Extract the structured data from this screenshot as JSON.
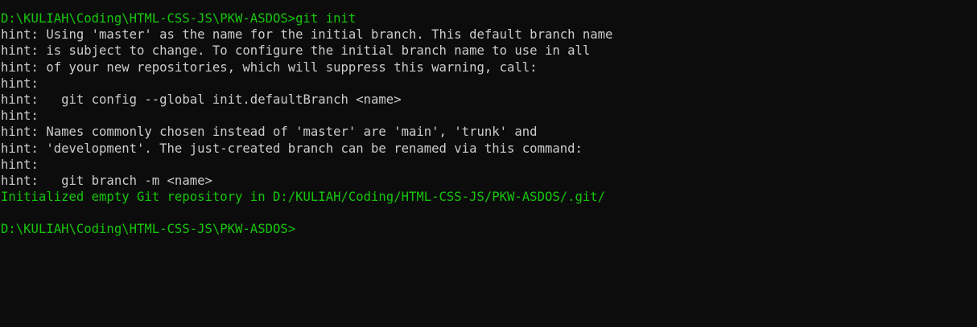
{
  "terminal": {
    "colors": {
      "background": "#0c0c0c",
      "text": "#cccccc",
      "prompt": "#16c60c"
    },
    "lines": [
      "hint: Using 'master' as the name for the initial branch. This default branch name",
      "hint: is subject to change. To configure the initial branch name to use in all",
      "hint: of your new repositories, which will suppress this warning, call:",
      "hint:",
      "hint:   git config --global init.defaultBranch <name>",
      "hint:",
      "hint: Names commonly chosen instead of 'master' are 'main', 'trunk' and",
      "hint: 'development'. The just-created branch can be renamed via this command:",
      "hint:",
      "hint:   git branch -m <name>",
      "Initialized empty Git repository in D:/KULIAH/Coding/HTML-CSS-JS/PKW-ASDOS/.git/"
    ],
    "prompt_path": "D:\\KULIAH\\Coding\\HTML-CSS-JS\\PKW-ASDOS>",
    "first_command": "git init"
  }
}
